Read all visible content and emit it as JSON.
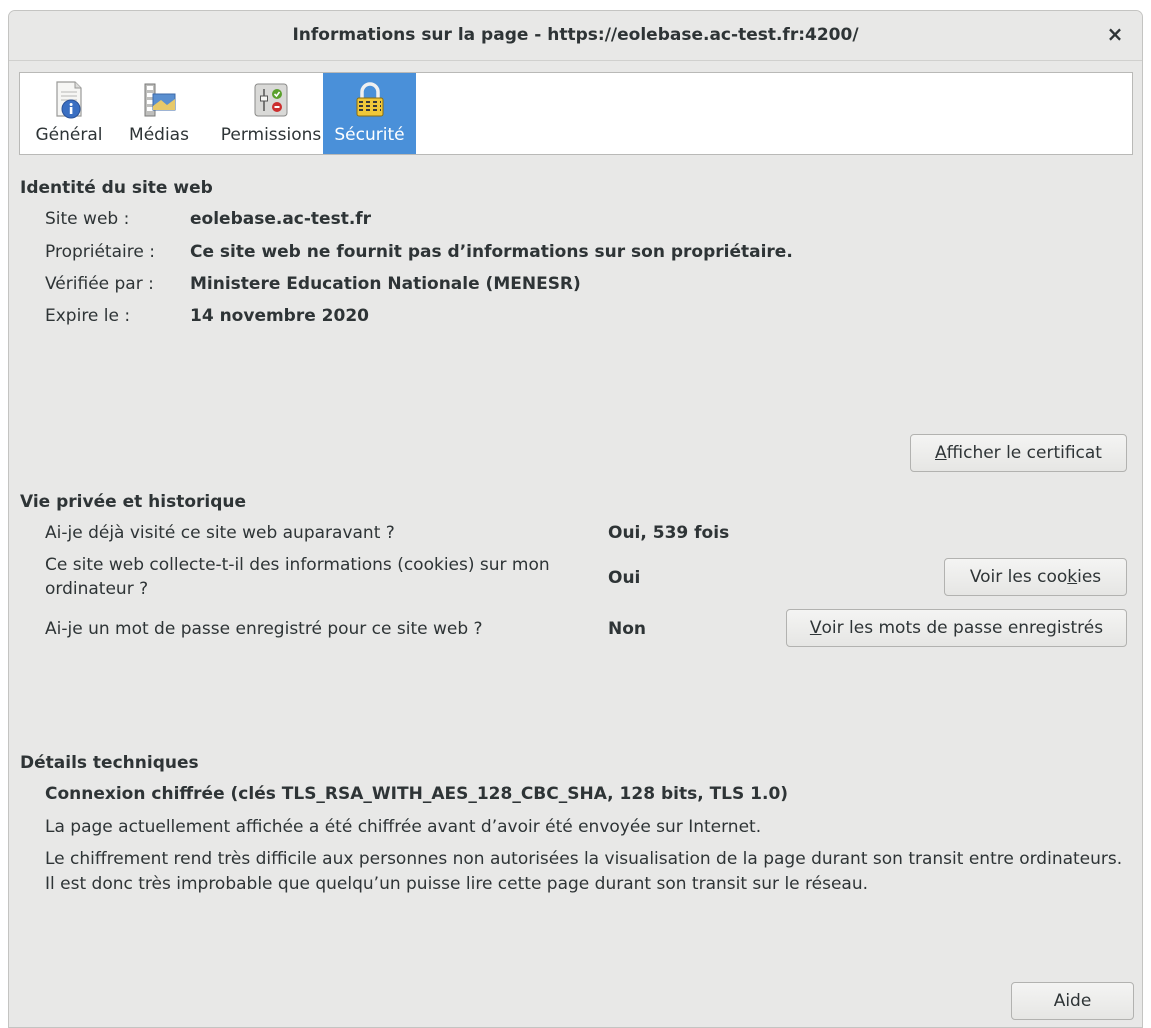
{
  "window": {
    "title": "Informations sur la page - https://eolebase.ac-test.fr:4200/",
    "close_label": "×"
  },
  "tabs": [
    {
      "label": "Général",
      "icon": "general-info-icon",
      "active": false
    },
    {
      "label": "Médias",
      "icon": "media-icon",
      "active": false
    },
    {
      "label": "Permissions",
      "icon": "permissions-icon",
      "active": false
    },
    {
      "label": "Sécurité",
      "icon": "lock-icon",
      "active": true
    }
  ],
  "identity": {
    "title": "Identité du site web",
    "rows": [
      {
        "label": "Site web :",
        "value": "eolebase.ac-test.fr"
      },
      {
        "label": "Propriétaire :",
        "value": "Ce site web ne fournit pas d’informations sur son propriétaire."
      },
      {
        "label": "Vérifiée par :",
        "value": "Ministere Education Nationale (MENESR)"
      },
      {
        "label": "Expire le :",
        "value": "14 novembre 2020"
      }
    ],
    "cert_button_pre": "",
    "cert_button_accel": "A",
    "cert_button_post": "fficher le certificat"
  },
  "privacy": {
    "title": "Vie privée et historique",
    "rows": [
      {
        "label": "Ai-je déjà visité ce site web auparavant ?",
        "value": "Oui, 539 fois"
      },
      {
        "label": "Ce site web collecte-t-il des informations (cookies) sur mon ordinateur ?",
        "value": "Oui"
      },
      {
        "label": "Ai-je un mot de passe enregistré pour ce site web ?",
        "value": "Non"
      }
    ],
    "cookies_button_pre": "Voir les coo",
    "cookies_button_accel": "k",
    "cookies_button_post": "ies",
    "passwords_button_pre": "",
    "passwords_button_accel": "V",
    "passwords_button_post": "oir les mots de passe enregistrés"
  },
  "technical": {
    "title": "Détails techniques",
    "connection": "Connexion chiffrée (clés TLS_RSA_WITH_AES_128_CBC_SHA, 128 bits, TLS 1.0)",
    "line1": "La page actuellement affichée a été chiffrée avant d’avoir été envoyée sur Internet.",
    "line2": "Le chiffrement rend très difficile aux personnes non autorisées la visualisation de la page durant son transit entre ordinateurs. Il est donc très improbable que quelqu’un puisse lire cette page durant son transit sur le réseau."
  },
  "help_button": "Aide",
  "colors": {
    "window_bg": "#e8e8e7",
    "active_tab": "#4a90d9",
    "text": "#2e3436"
  }
}
